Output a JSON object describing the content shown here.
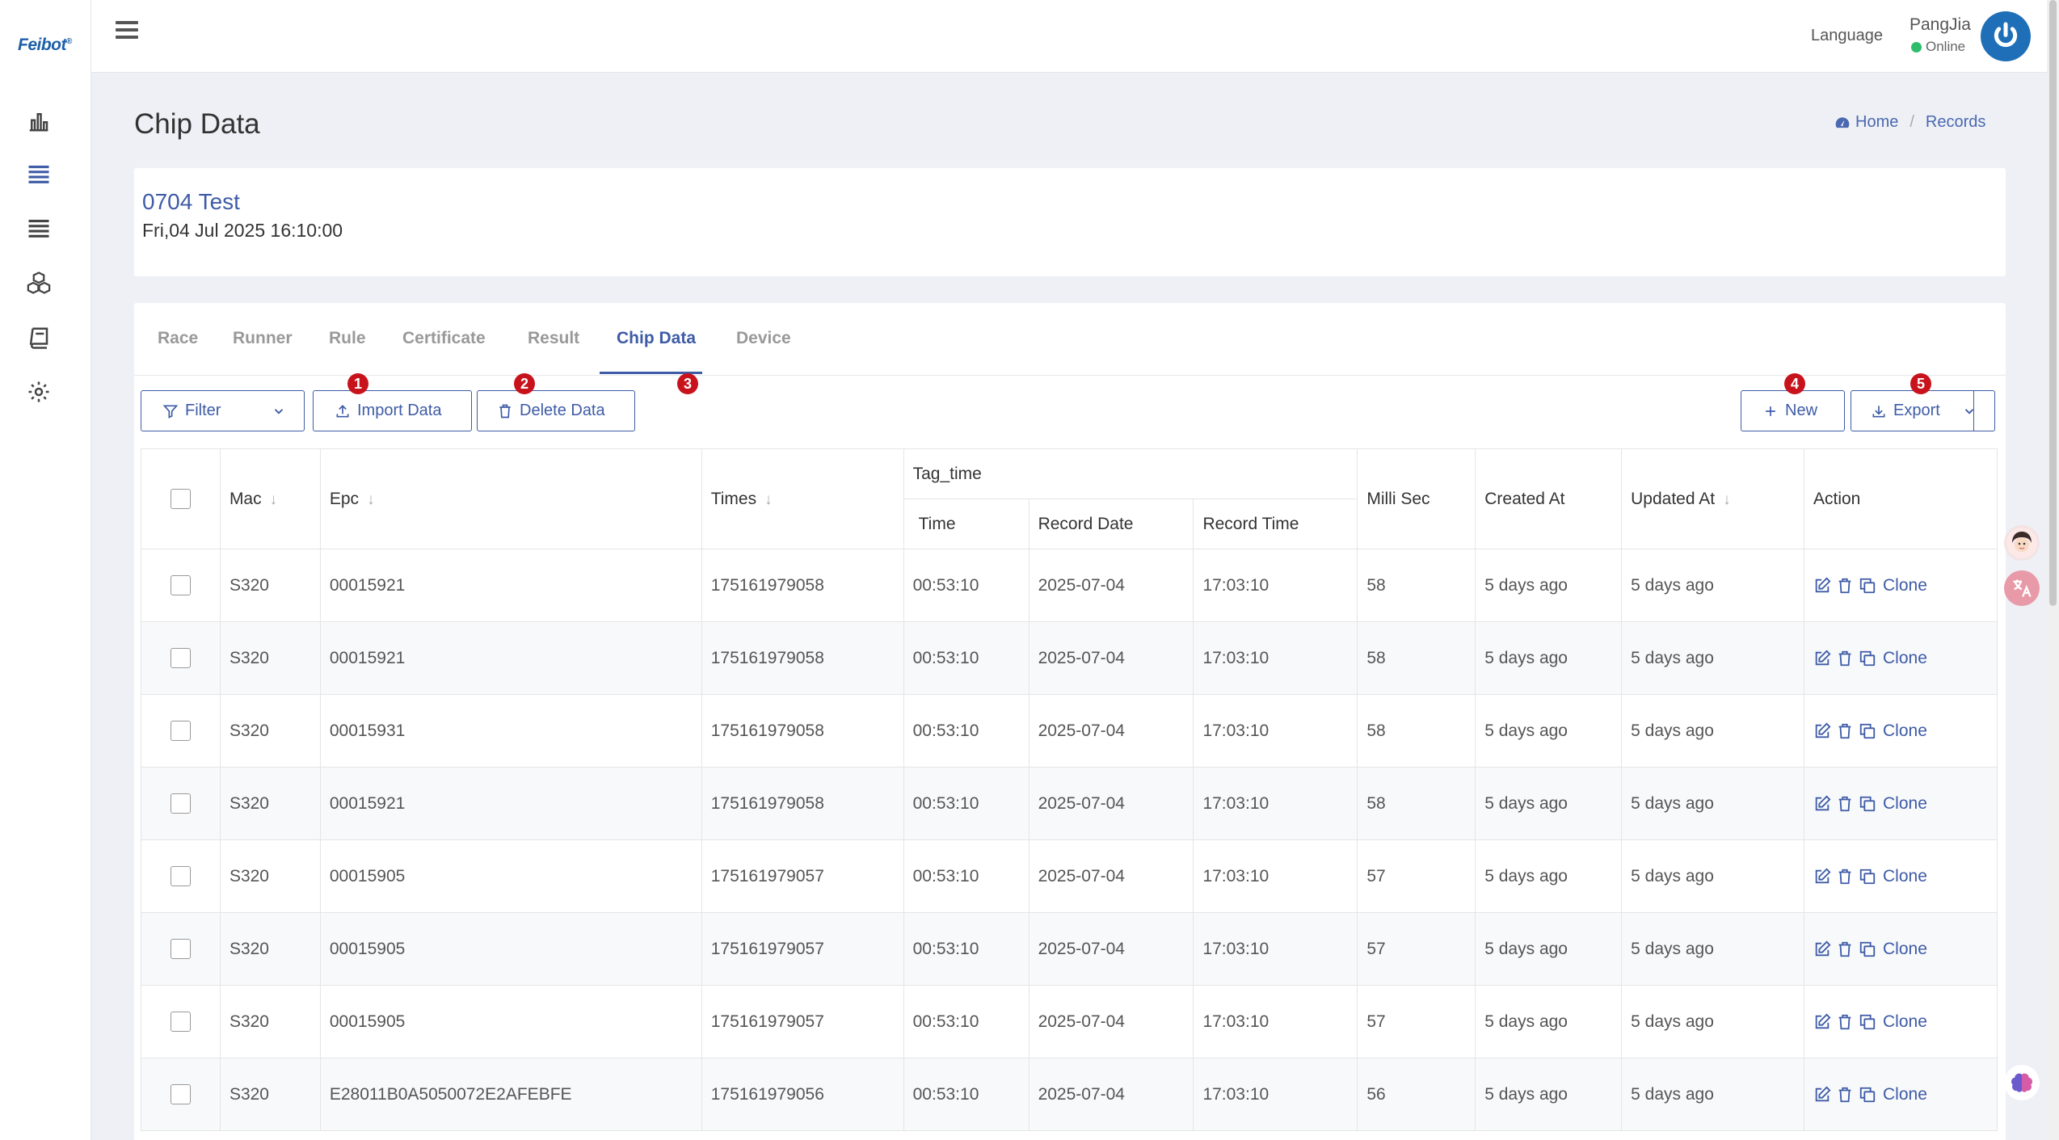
{
  "brand": {
    "name": "Feibot",
    "mark": "®"
  },
  "sidebar": {
    "items": [
      {
        "icon": "bar-chart-icon"
      },
      {
        "icon": "list-icon"
      },
      {
        "icon": "stack-list-icon"
      },
      {
        "icon": "cubes-icon"
      },
      {
        "icon": "book-icon"
      },
      {
        "icon": "gear-icon"
      }
    ]
  },
  "topbar": {
    "language": "Language",
    "user_name": "PangJia",
    "user_status": "Online",
    "status_color": "#2ebd6b"
  },
  "page": {
    "title": "Chip Data"
  },
  "breadcrumb": {
    "home": "Home",
    "current": "Records"
  },
  "race": {
    "name": "0704 Test",
    "date": "Fri,04 Jul 2025 16:10:00"
  },
  "tabs": [
    "Race",
    "Runner",
    "Rule",
    "Certificate",
    "Result",
    "Chip Data",
    "Device"
  ],
  "active_tab": "Chip Data",
  "toolbar": {
    "filter": "Filter",
    "import": "Import Data",
    "delete": "Delete Data",
    "new": "New",
    "export": "Export",
    "badges": [
      "1",
      "2",
      "3",
      "4",
      "5"
    ]
  },
  "table": {
    "headers": {
      "mac": "Mac",
      "epc": "Epc",
      "times": "Times",
      "tag_time": "Tag_time",
      "time": "Time",
      "record_date": "Record Date",
      "record_time": "Record Time",
      "milli_sec": "Milli Sec",
      "created_at": "Created At",
      "updated_at": "Updated At",
      "action": "Action"
    },
    "clone_label": "Clone",
    "rows": [
      {
        "mac": "S320",
        "epc": "00015921",
        "times": "175161979058",
        "time": "00:53:10",
        "record_date": "2025-07-04",
        "record_time": "17:03:10",
        "milli_sec": "58",
        "created_at": "5 days ago",
        "updated_at": "5 days ago"
      },
      {
        "mac": "S320",
        "epc": "00015921",
        "times": "175161979058",
        "time": "00:53:10",
        "record_date": "2025-07-04",
        "record_time": "17:03:10",
        "milli_sec": "58",
        "created_at": "5 days ago",
        "updated_at": "5 days ago"
      },
      {
        "mac": "S320",
        "epc": "00015931",
        "times": "175161979058",
        "time": "00:53:10",
        "record_date": "2025-07-04",
        "record_time": "17:03:10",
        "milli_sec": "58",
        "created_at": "5 days ago",
        "updated_at": "5 days ago"
      },
      {
        "mac": "S320",
        "epc": "00015921",
        "times": "175161979058",
        "time": "00:53:10",
        "record_date": "2025-07-04",
        "record_time": "17:03:10",
        "milli_sec": "58",
        "created_at": "5 days ago",
        "updated_at": "5 days ago"
      },
      {
        "mac": "S320",
        "epc": "00015905",
        "times": "175161979057",
        "time": "00:53:10",
        "record_date": "2025-07-04",
        "record_time": "17:03:10",
        "milli_sec": "57",
        "created_at": "5 days ago",
        "updated_at": "5 days ago"
      },
      {
        "mac": "S320",
        "epc": "00015905",
        "times": "175161979057",
        "time": "00:53:10",
        "record_date": "2025-07-04",
        "record_time": "17:03:10",
        "milli_sec": "57",
        "created_at": "5 days ago",
        "updated_at": "5 days ago"
      },
      {
        "mac": "S320",
        "epc": "00015905",
        "times": "175161979057",
        "time": "00:53:10",
        "record_date": "2025-07-04",
        "record_time": "17:03:10",
        "milli_sec": "57",
        "created_at": "5 days ago",
        "updated_at": "5 days ago"
      },
      {
        "mac": "S320",
        "epc": "E28011B0A5050072E2AFEBFE",
        "times": "175161979056",
        "time": "00:53:10",
        "record_date": "2025-07-04",
        "record_time": "17:03:10",
        "milli_sec": "56",
        "created_at": "5 days ago",
        "updated_at": "5 days ago"
      }
    ]
  },
  "colors": {
    "accent": "#3e5ba6",
    "badge": "#c8131d",
    "brand": "#1d5fa8"
  }
}
